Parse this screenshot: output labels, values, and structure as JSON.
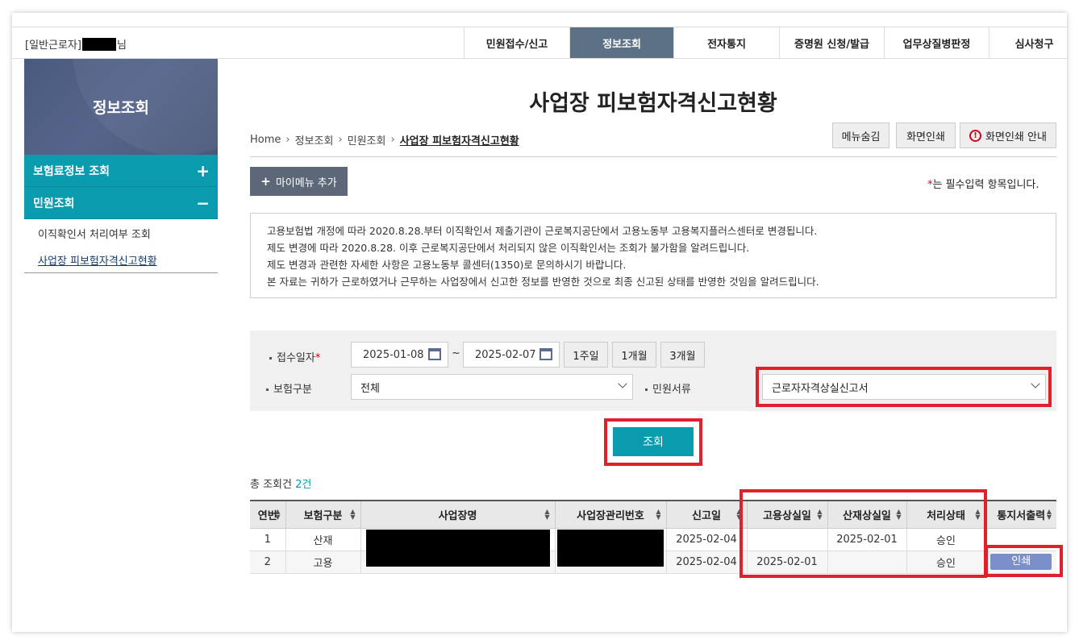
{
  "header": {
    "user_prefix": "[일반근로자]",
    "user_suffix": "님",
    "nav": [
      {
        "label": "민원접수/신고",
        "active": false
      },
      {
        "label": "정보조회",
        "active": true
      },
      {
        "label": "전자통지",
        "active": false
      },
      {
        "label": "증명원 신청/발급",
        "active": false
      },
      {
        "label": "업무상질병판정",
        "active": false
      },
      {
        "label": "심사청구",
        "active": false
      }
    ]
  },
  "sidebar": {
    "title": "정보조회",
    "menus": [
      {
        "label": "보험료정보 조회",
        "sign": "+"
      },
      {
        "label": "민원조회",
        "sign": "−"
      }
    ],
    "subitems": [
      {
        "label": "이직확인서 처리여부 조회"
      },
      {
        "label": "사업장 피보험자격신고현황"
      }
    ]
  },
  "page": {
    "title": "사업장 피보험자격신고현황",
    "breadcrumb": [
      "Home",
      "정보조회",
      "민원조회",
      "사업장 피보험자격신고현황"
    ],
    "util_buttons": {
      "hide_menu": "메뉴숨김",
      "print": "화면인쇄",
      "print_guide": "화면인쇄 안내",
      "warn_glyph": "!"
    },
    "mymenu": "마이메뉴 추가",
    "mymenu_icon": "+",
    "required_note": "는 필수입력 항목입니다.",
    "required_star": "*",
    "notice": [
      "고용보험법 개정에 따라 2020.8.28.부터 이직확인서 제출기관이 근로복지공단에서 고용노동부 고용복지플러스센터로 변경됩니다.",
      "제도 변경에 따라 2020.8.28. 이후 근로복지공단에서 처리되지 않은 이직확인서는 조회가 불가함을 알려드립니다.",
      "제도 변경과 관련한 자세한 사항은 고용노동부 콜센터(1350)로 문의하시기 바랍니다.",
      "본 자료는 귀하가 근로하였거나 근무하는 사업장에서 신고한 정보를 반영한 것으로 최종 신고된 상태를 반영한 것임을 알려드립니다."
    ]
  },
  "search": {
    "date_label": "접수일자",
    "date_star": "*",
    "date_from": "2025-01-08",
    "tilde": "~",
    "date_to": "2025-02-07",
    "quick": [
      "1주일",
      "1개월",
      "3개월"
    ],
    "insurance_label": "보험구분",
    "insurance_value": "전체",
    "doc_label": "민원서류",
    "doc_value": "근로자자격상실신고서",
    "query_button": "조회"
  },
  "results": {
    "total_label": "총 조회건",
    "total_count": "2건",
    "columns": [
      "연번",
      "보험구분",
      "사업장명",
      "사업장관리번호",
      "신고일",
      "고용상실일",
      "산재상실일",
      "처리상태",
      "통지서출력"
    ],
    "rows": [
      {
        "no": "1",
        "type": "산재",
        "date": "2025-02-04",
        "emp_loss": "",
        "ind_loss": "2025-02-01",
        "status": "승인",
        "print": ""
      },
      {
        "no": "2",
        "type": "고용",
        "date": "2025-02-04",
        "emp_loss": "2025-02-01",
        "ind_loss": "",
        "status": "승인",
        "print": "인쇄"
      }
    ]
  },
  "colors": {
    "accent": "#0a9cae",
    "nav_active": "#5d7186",
    "highlight": "#e0202a",
    "print_button": "#7b90c8"
  }
}
